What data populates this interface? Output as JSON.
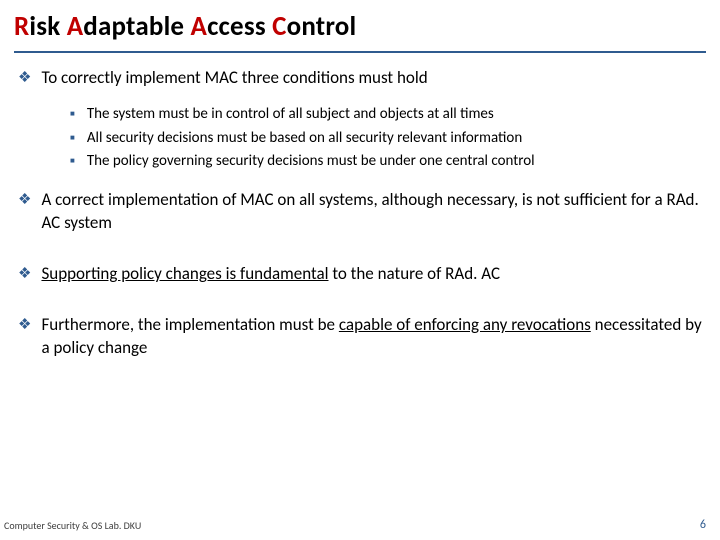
{
  "title": {
    "word1_initial": "R",
    "word1_rest": "isk ",
    "word2_initial": "A",
    "word2_rest": "daptable ",
    "word3_initial": "A",
    "word3_rest": "ccess ",
    "word4_initial": "C",
    "word4_rest": "ontrol"
  },
  "bullets": {
    "b1": "To correctly implement MAC three conditions must hold",
    "sub1": "The system must be in control of all subject and objects at all times",
    "sub2": "All security decisions must be based on all security relevant information",
    "sub3": "The policy governing security decisions must be under one central control",
    "b2": "A correct implementation of MAC on all systems, although necessary, is not sufficient for a RAd. AC system",
    "b3_u": "Supporting policy changes is fundamental",
    "b3_rest": " to the nature of RAd. AC",
    "b4_a": "Furthermore, the implementation must be ",
    "b4_u": "capable of enforcing any revocations",
    "b4_b": " necessitated by a policy change"
  },
  "footer": {
    "left": "Computer Security & OS Lab. DKU",
    "page": "6"
  }
}
